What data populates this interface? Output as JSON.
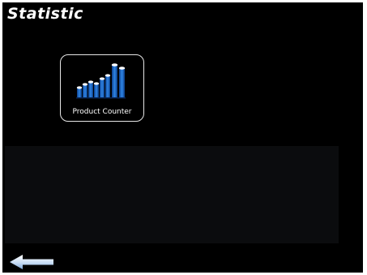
{
  "header": {
    "title": "Statistic"
  },
  "tiles": [
    {
      "label": "Product Counter",
      "icon": "bar-chart-icon",
      "icon_color": "#1e6fd0"
    }
  ],
  "navigation": {
    "back_icon": "back-arrow-icon"
  },
  "colors": {
    "background": "#000000",
    "panel": "#0b0c0e",
    "text": "#ffffff",
    "accent": "#1e6fd0"
  }
}
